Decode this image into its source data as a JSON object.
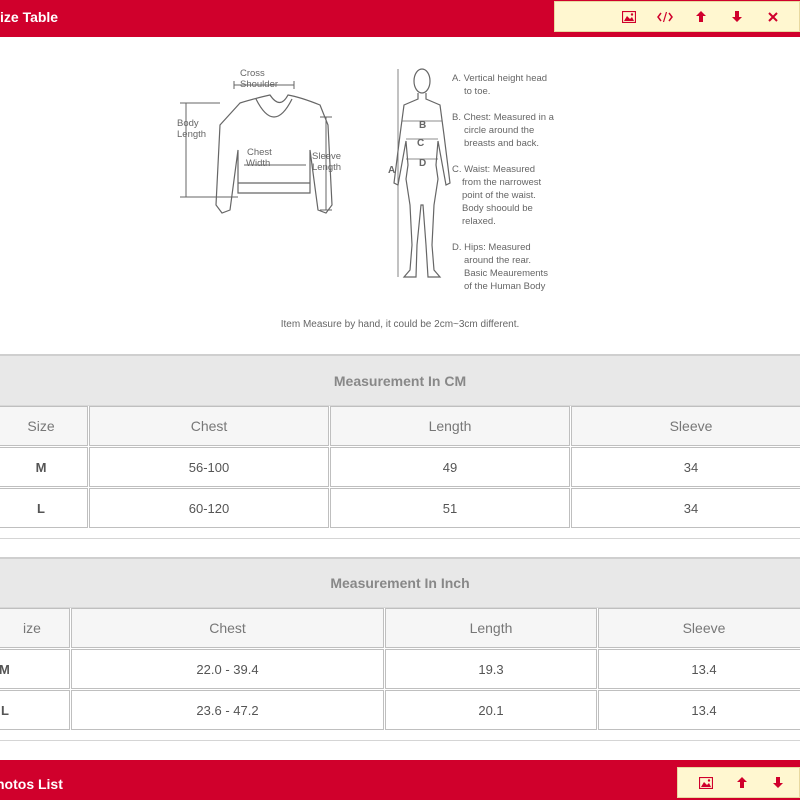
{
  "top_bar": {
    "title": "ize Table",
    "buttons": [
      "image-icon",
      "code-icon",
      "arrow-up-icon",
      "arrow-down-icon",
      "close-icon"
    ]
  },
  "diagram": {
    "shirt_labels": {
      "cross_shoulder_1": "Cross",
      "cross_shoulder_2": "Shoulder",
      "body_length_1": "Body",
      "body_length_2": "Length",
      "chest_width_1": "Chest",
      "chest_width_2": "Width",
      "sleeve_length_1": "Sleeve",
      "sleeve_length_2": "Length"
    },
    "body_letters": {
      "a": "A",
      "b": "B",
      "c": "C",
      "d": "D"
    },
    "legend": [
      "A. Vertical height head",
      "to toe.",
      "B. Chest: Measured in a",
      "circle around the",
      "breasts and back.",
      "C. Waist: Measured",
      "from the narrowest",
      "point of the waist.",
      "Body shoould be",
      "relaxed.",
      "D. Hips: Measured",
      "around the rear.",
      "Basic Meaurements",
      "of the Human Body"
    ],
    "note": "Item Measure by hand, it could be 2cm~3cm different."
  },
  "cm_table": {
    "title": "Measurement In CM",
    "headers": [
      "Size",
      "Chest",
      "Length",
      "Sleeve"
    ],
    "rows": [
      [
        "M",
        "56-100",
        "49",
        "34"
      ],
      [
        "L",
        "60-120",
        "51",
        "34"
      ]
    ]
  },
  "inch_table": {
    "title": "Measurement In Inch",
    "headers": [
      "ize",
      "Chest",
      "Length",
      "Sleeve"
    ],
    "rows": [
      [
        "M",
        "22.0 - 39.4",
        "19.3",
        "13.4"
      ],
      [
        "L",
        "23.6 - 47.2",
        "20.1",
        "13.4"
      ]
    ]
  },
  "bottom_bar": {
    "title": "hotos List",
    "buttons": [
      "image-icon",
      "arrow-up-icon",
      "arrow-down-icon"
    ]
  },
  "colors": {
    "brand_red": "#d0002c",
    "toolbar_bg": "#fff7d0"
  }
}
